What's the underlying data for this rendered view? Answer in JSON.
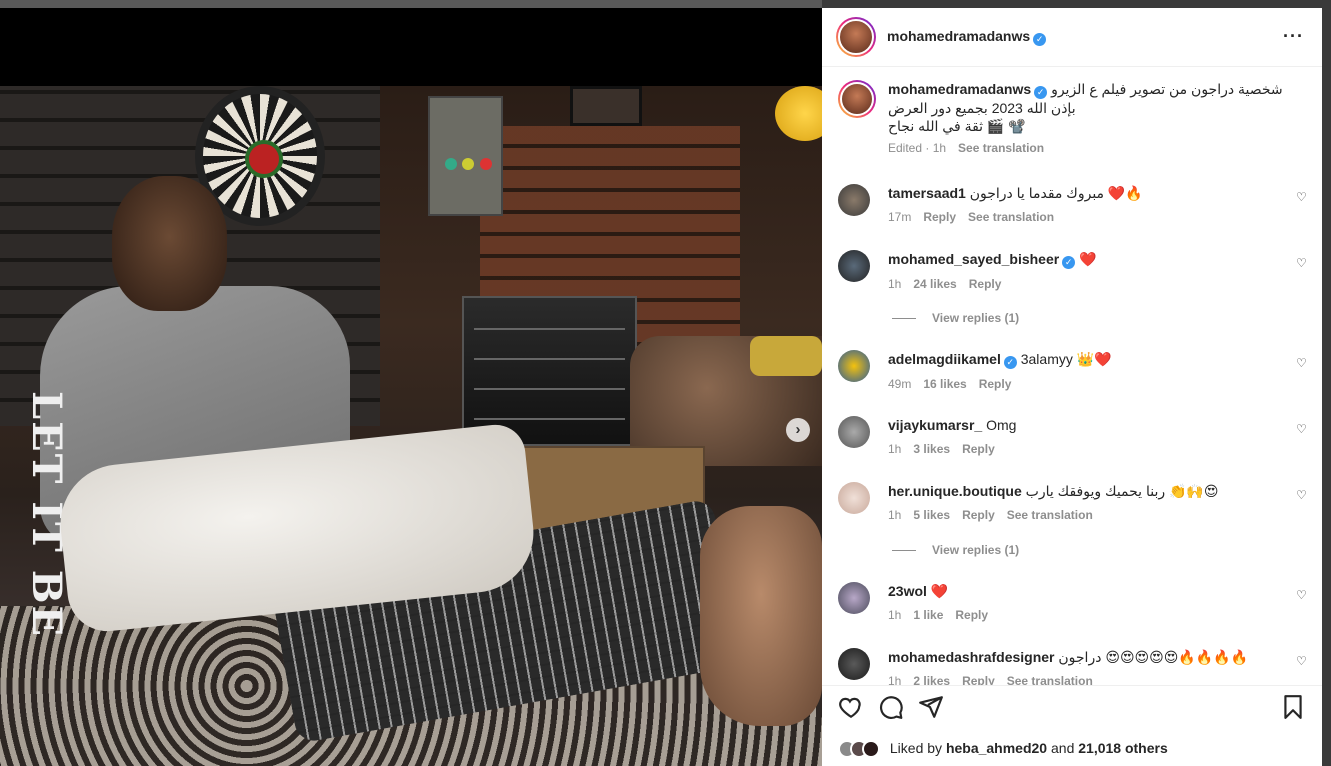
{
  "post": {
    "author": "mohamedramadanws",
    "caption_author": "mohamedramadanws",
    "caption_line1": "شخصية دراجون من تصوير فيلم ع الزيرو",
    "caption_line2": "بإذن الله 2023 بجميع دور العرض",
    "caption_line3": "ثقة في الله نجاح 🎬 📽️",
    "caption_meta_edited": "Edited · 1h",
    "caption_meta_translate": "See translation",
    "photo_lettering": "LET IT BE",
    "next_arrow": "›",
    "more_icon": "···"
  },
  "comments": [
    {
      "user": "tamersaad1",
      "text": "مبروك مقدما يا دراجون ❤️🔥",
      "verified": false,
      "time": "17m",
      "likes": "",
      "reply": "Reply",
      "translate": "See translation"
    },
    {
      "user": "mohamed_sayed_bisheer",
      "text": "❤️",
      "verified": true,
      "time": "1h",
      "likes": "24 likes",
      "reply": "Reply",
      "translate": "",
      "view_replies": "View replies (1)"
    },
    {
      "user": "adelmagdiikamel",
      "text": "3alamyy 👑❤️",
      "verified": true,
      "time": "49m",
      "likes": "16 likes",
      "reply": "Reply",
      "translate": ""
    },
    {
      "user": "vijaykumarsr_",
      "text": "Omg",
      "verified": false,
      "time": "1h",
      "likes": "3 likes",
      "reply": "Reply",
      "translate": ""
    },
    {
      "user": "her.unique.boutique",
      "text": "ربنا يحميك ويوفقك يارب 👏🙌😍",
      "verified": false,
      "time": "1h",
      "likes": "5 likes",
      "reply": "Reply",
      "translate": "See translation",
      "view_replies": "View replies (1)"
    },
    {
      "user": "23wol",
      "text": "❤️",
      "verified": false,
      "time": "1h",
      "likes": "1 like",
      "reply": "Reply",
      "translate": ""
    },
    {
      "user": "mohamedashrafdesigner",
      "text": "دراجون 😍😍😍😍😍🔥🔥🔥🔥",
      "verified": false,
      "time": "1h",
      "likes": "2 likes",
      "reply": "Reply",
      "translate": "See translation"
    }
  ],
  "likes": {
    "prefix": "Liked by",
    "user": "heba_ahmed20",
    "middle": "and",
    "others": "21,018 others"
  },
  "colors": {
    "verified": "#3897f0",
    "heart": "#ed4956",
    "muted": "#8e8e8e"
  }
}
